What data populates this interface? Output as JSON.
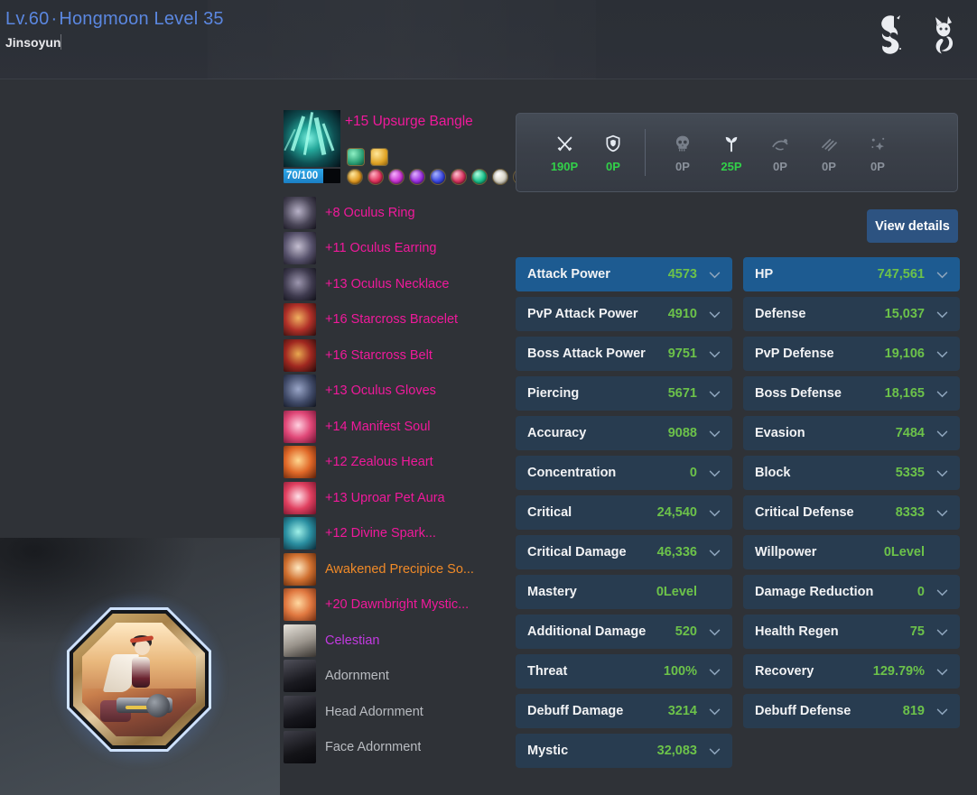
{
  "header": {
    "level": "Lv.60",
    "separator": "·",
    "hongmoon_level": "Hongmoon Level 35",
    "character_name": "Jinsoyun",
    "emblems": [
      "dragon-emblem",
      "fox-emblem"
    ]
  },
  "equipment": {
    "weapon": {
      "label": "+15 Upsurge Bangle",
      "color": "#f0199b",
      "durability": "70/100",
      "durability_percent": 70,
      "badges": [
        {
          "name": "badge-green",
          "color": "#3fbf8a"
        },
        {
          "name": "badge-gold",
          "color": "#f0c03a"
        }
      ],
      "gems": [
        {
          "name": "gem-amber",
          "color": "#e8a game"
        },
        {
          "name": "gem-red",
          "color": "#e0325c"
        },
        {
          "name": "gem-magenta",
          "color": "#c832d0"
        },
        {
          "name": "gem-violet",
          "color": "#9a2ee0"
        },
        {
          "name": "gem-blue",
          "color": "#3a46e0"
        },
        {
          "name": "gem-crimson",
          "color": "#d8325e"
        },
        {
          "name": "gem-teal",
          "color": "#18c08a"
        },
        {
          "name": "gem-white",
          "color": "#e8e4d8"
        },
        {
          "name": "gem-black",
          "color": "#2a2a30"
        }
      ]
    },
    "items": [
      {
        "label": "+8 Oculus Ring",
        "color": "pink",
        "icon": "ring-icon"
      },
      {
        "label": "+11 Oculus Earring",
        "color": "pink",
        "icon": "earring-icon"
      },
      {
        "label": "+13 Oculus Necklace",
        "color": "pink",
        "icon": "necklace-icon"
      },
      {
        "label": "+16 Starcross Bracelet",
        "color": "pink",
        "icon": "bracelet-icon"
      },
      {
        "label": "+16 Starcross Belt",
        "color": "pink",
        "icon": "belt-icon"
      },
      {
        "label": "+13 Oculus Gloves",
        "color": "pink",
        "icon": "gloves-icon"
      },
      {
        "label": "+14 Manifest Soul",
        "color": "pink",
        "icon": "soul-icon"
      },
      {
        "label": "+12 Zealous Heart",
        "color": "pink",
        "icon": "heart-icon"
      },
      {
        "label": "+13 Uproar Pet Aura",
        "color": "pink",
        "icon": "pet-aura-icon"
      },
      {
        "label": "+12 Divine Spark...",
        "color": "pink",
        "icon": "spark-icon"
      },
      {
        "label": "Awakened Precipice So...",
        "color": "orange",
        "icon": "soul-badge-icon"
      },
      {
        "label": "+20 Dawnbright Mystic...",
        "color": "pink",
        "icon": "mystic-badge-icon"
      },
      {
        "label": "Celestian",
        "color": "purple",
        "icon": "outfit-icon"
      },
      {
        "label": "Adornment",
        "color": "gray",
        "icon": "adornment-icon"
      },
      {
        "label": "Head Adornment",
        "color": "gray",
        "icon": "head-adornment-icon"
      },
      {
        "label": "Face Adornment",
        "color": "gray",
        "icon": "face-adornment-icon"
      }
    ]
  },
  "mastery_bar": {
    "left": [
      {
        "icon": "crossed-swords-icon",
        "value": "190P",
        "active": true
      },
      {
        "icon": "shield-icon",
        "value": "0P",
        "active": true
      }
    ],
    "right": [
      {
        "icon": "skull-icon",
        "value": "0P",
        "active": false
      },
      {
        "icon": "sprout-icon",
        "value": "25P",
        "active": true
      },
      {
        "icon": "fishing-icon",
        "value": "0P",
        "active": false
      },
      {
        "icon": "mining-icon",
        "value": "0P",
        "active": false
      },
      {
        "icon": "star-icon",
        "value": "0P",
        "active": false
      }
    ]
  },
  "actions": {
    "view_details": "View details"
  },
  "stats": {
    "left_column": [
      {
        "name": "Attack Power",
        "value": "4573",
        "highlight": true,
        "expandable": true
      },
      {
        "name": "PvP Attack Power",
        "value": "4910",
        "highlight": false,
        "expandable": true
      },
      {
        "name": "Boss Attack Power",
        "value": "9751",
        "highlight": false,
        "expandable": true
      },
      {
        "name": "Piercing",
        "value": "5671",
        "highlight": false,
        "expandable": true
      },
      {
        "name": "Accuracy",
        "value": "9088",
        "highlight": false,
        "expandable": true
      },
      {
        "name": "Concentration",
        "value": "0",
        "highlight": false,
        "expandable": true
      },
      {
        "name": "Critical",
        "value": "24,540",
        "highlight": false,
        "expandable": true
      },
      {
        "name": "Critical Damage",
        "value": "46,336",
        "highlight": false,
        "expandable": true
      },
      {
        "name": "Mastery",
        "value": "0Level",
        "highlight": false,
        "expandable": false
      },
      {
        "name": "Additional Damage",
        "value": "520",
        "highlight": false,
        "expandable": true
      },
      {
        "name": "Threat",
        "value": "100%",
        "highlight": false,
        "expandable": true
      },
      {
        "name": "Debuff Damage",
        "value": "3214",
        "highlight": false,
        "expandable": true
      },
      {
        "name": "Mystic",
        "value": "32,083",
        "highlight": false,
        "expandable": true
      }
    ],
    "right_column": [
      {
        "name": "HP",
        "value": "747,561",
        "highlight": true,
        "expandable": true
      },
      {
        "name": "Defense",
        "value": "15,037",
        "highlight": false,
        "expandable": true
      },
      {
        "name": "PvP Defense",
        "value": "19,106",
        "highlight": false,
        "expandable": true
      },
      {
        "name": "Boss Defense",
        "value": "18,165",
        "highlight": false,
        "expandable": true
      },
      {
        "name": "Evasion",
        "value": "7484",
        "highlight": false,
        "expandable": true
      },
      {
        "name": "Block",
        "value": "5335",
        "highlight": false,
        "expandable": true
      },
      {
        "name": "Critical Defense",
        "value": "8333",
        "highlight": false,
        "expandable": true
      },
      {
        "name": "Willpower",
        "value": "0Level",
        "highlight": false,
        "expandable": false
      },
      {
        "name": "Damage Reduction",
        "value": "0",
        "highlight": false,
        "expandable": true
      },
      {
        "name": "Health Regen",
        "value": "75",
        "highlight": false,
        "expandable": true
      },
      {
        "name": "Recovery",
        "value": "129.79%",
        "highlight": false,
        "expandable": true
      },
      {
        "name": "Debuff Defense",
        "value": "819",
        "highlight": false,
        "expandable": true
      }
    ]
  },
  "colors": {
    "accent_blue": "#5b87e0",
    "stat_value_green": "#6cc24a",
    "highlight_row": "#1d5b91",
    "row_bg": "#283c50",
    "item_pink": "#f0199b",
    "item_orange": "#f08a28",
    "item_purple": "#c23ae0",
    "item_gray": "#b9bcc1"
  }
}
